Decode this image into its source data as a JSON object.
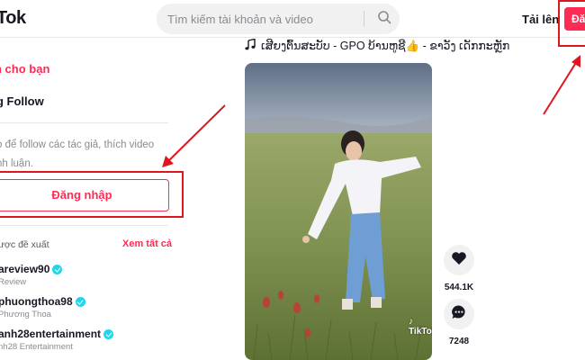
{
  "header": {
    "logo_text": "Tok",
    "search_placeholder": "Tìm kiếm tài khoản và video",
    "upload_label": "Tải lên",
    "login_label": "Đăng"
  },
  "sidebar": {
    "nav_for_you": "h cho bạn",
    "nav_following": "g Follow",
    "login_hint": "o để follow các tác giả, thích video\nnh luận.",
    "login_button": "Đăng nhập",
    "suggested_title": "ược đề xuất",
    "see_all": "Xem tất cả",
    "accounts": [
      {
        "name": "areview90",
        "subtitle": "Review",
        "verified": true
      },
      {
        "name": "phuongthoa98",
        "subtitle": "Phương Thoa",
        "verified": true
      },
      {
        "name": "anh28entertainment",
        "subtitle": "nh28 Entertainment",
        "verified": true
      }
    ]
  },
  "video": {
    "caption": "ເສີຍງຕົ້ນສະບັບ - GPO ບ້ານຫູຊີ👍 - ຂາວັງ ເດັກກະຫຼັກ",
    "watermark": "TikTok",
    "likes": "544.1K",
    "comments": "7248"
  },
  "colors": {
    "brand": "#fe2c55",
    "annotation": "#e0161f",
    "verified": "#20d5ec"
  },
  "icons": [
    "search-icon",
    "music-note-icon",
    "heart-icon",
    "comment-icon",
    "verified-icon",
    "tiktok-logo-icon"
  ]
}
